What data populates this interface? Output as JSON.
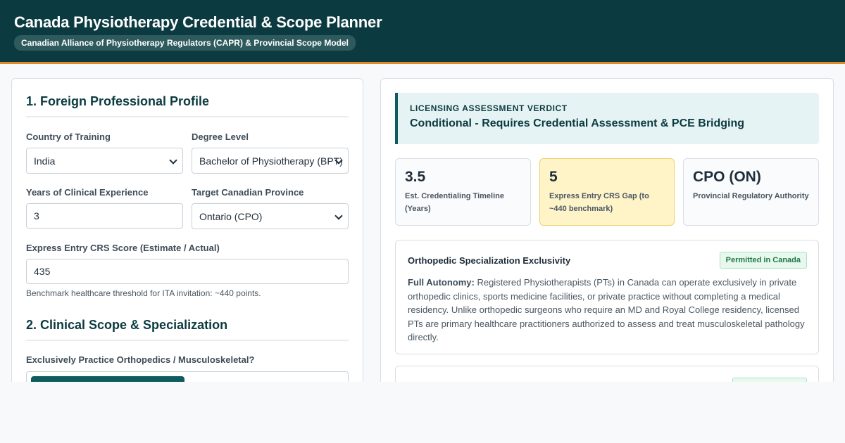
{
  "header": {
    "title": "Canada Physiotherapy Credential & Scope Planner",
    "subtitle": "Canadian Alliance of Physiotherapy Regulators (CAPR) & Provincial Scope Model"
  },
  "profile": {
    "section_title": "1. Foreign Professional Profile",
    "country_label": "Country of Training",
    "country_value": "India",
    "degree_label": "Degree Level",
    "degree_value": "Bachelor of Physiotherapy (BPT)",
    "experience_label": "Years of Clinical Experience",
    "experience_value": "3",
    "province_label": "Target Canadian Province",
    "province_value": "Ontario (CPO)",
    "crs_label": "Express Entry CRS Score (Estimate / Actual)",
    "crs_value": "435",
    "crs_help": "Benchmark healthcare threshold for ITA invitation: ~440 points."
  },
  "scope_section": {
    "section_title": "2. Clinical Scope & Specialization",
    "ortho_question": "Exclusively Practice Orthopedics / Musculoskeletal?"
  },
  "verdict": {
    "label": "LICENSING ASSESSMENT VERDICT",
    "value": "Conditional - Requires Credential Assessment & PCE Bridging"
  },
  "metrics": [
    {
      "value": "3.5",
      "label": "Est. Credentialing Timeline (Years)"
    },
    {
      "value": "5",
      "label": "Express Entry CRS Gap (to ~440 benchmark)"
    },
    {
      "value": "CPO (ON)",
      "label": "Provincial Regulatory Authority"
    }
  ],
  "scope_cards": [
    {
      "title": "Orthopedic Specialization Exclusivity",
      "badge": "Permitted in Canada",
      "lead": "Full Autonomy:",
      "text": " Registered Physiotherapists (PTs) in Canada can operate exclusively in private orthopedic clinics, sports medicine facilities, or private practice without completing a medical residency. Unlike orthopedic surgeons who require an MD and Royal College residency, licensed PTs are primary healthcare practitioners authorized to assess and treat musculoskeletal pathology directly."
    }
  ],
  "colors": {
    "header_bg": "#0b3b40",
    "accent": "#e0892a",
    "primary": "#0e5c5e",
    "warn_bg": "#fff3c8",
    "success": "#1f7a43"
  }
}
